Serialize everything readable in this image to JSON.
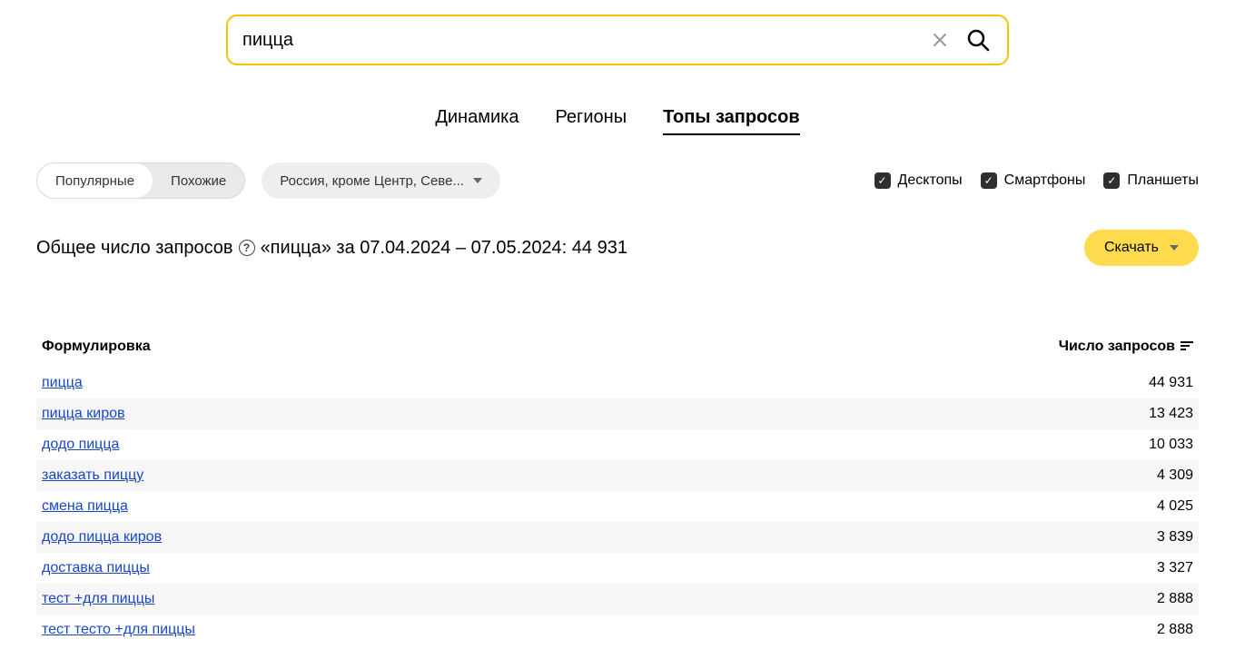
{
  "search": {
    "value": "пицца"
  },
  "tabs": {
    "dynamics": "Динамика",
    "regions": "Регионы",
    "tops": "Топы запросов"
  },
  "segmented": {
    "popular": "Популярные",
    "similar": "Похожие"
  },
  "region": {
    "label": "Россия, кроме Центр, Севе..."
  },
  "devices": {
    "desktops": "Десктопы",
    "smartphones": "Смартфоны",
    "tablets": "Планшеты"
  },
  "summary": {
    "prefix": "Общее число запросов",
    "rest": "«пицца» за 07.04.2024 – 07.05.2024: 44 931"
  },
  "download": {
    "label": "Скачать"
  },
  "table": {
    "col_query": "Формулировка",
    "col_count": "Число запросов",
    "rows": [
      {
        "query": "пицца",
        "count": "44 931"
      },
      {
        "query": "пицца киров",
        "count": "13 423"
      },
      {
        "query": "додо пицца",
        "count": "10 033"
      },
      {
        "query": "заказать пиццу",
        "count": "4 309"
      },
      {
        "query": "смена пицца",
        "count": "4 025"
      },
      {
        "query": "додо пицца киров",
        "count": "3 839"
      },
      {
        "query": "доставка пиццы",
        "count": "3 327"
      },
      {
        "query": "тест +для пиццы",
        "count": "2 888"
      },
      {
        "query": "тест тесто +для пиццы",
        "count": "2 888"
      }
    ]
  }
}
